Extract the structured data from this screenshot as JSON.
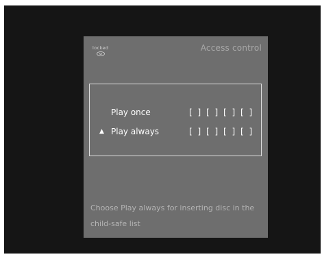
{
  "screen": {
    "lock_status": "locked",
    "title": "Access control"
  },
  "options": [
    {
      "label": "Play once",
      "selected": false,
      "code_slots": "[ ] [ ] [ ] [ ]"
    },
    {
      "label": "Play always",
      "selected": true,
      "code_slots": "[ ] [ ] [ ] [ ]",
      "marker": "▲"
    }
  ],
  "help": {
    "line1": "Choose  Play always  for inserting disc in the",
    "line2": "child-safe list"
  },
  "colors": {
    "background": "#151515",
    "panel": "#6e6e6e",
    "text": "#ffffff",
    "muted_text": "#b4b4b4"
  },
  "icons": {
    "lock": "disc-icon",
    "selection": "up-triangle-marker"
  }
}
